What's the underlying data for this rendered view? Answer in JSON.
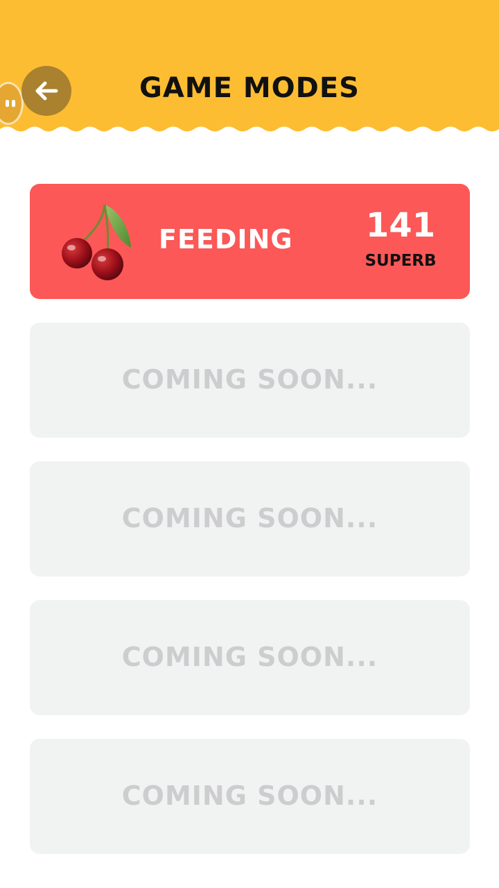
{
  "header": {
    "title": "GAME MODES",
    "back_icon": "arrow-left-icon",
    "colors": {
      "bar": "#fdbd32",
      "back_button": "#a9812f"
    }
  },
  "modes": [
    {
      "label": "FEEDING",
      "icon": "cherry-icon",
      "score": "141",
      "rating": "SUPERB",
      "color": "#fb5857",
      "locked": false
    },
    {
      "label": "COMING SOON...",
      "locked": true
    },
    {
      "label": "COMING SOON...",
      "locked": true
    },
    {
      "label": "COMING SOON...",
      "locked": true
    },
    {
      "label": "COMING SOON...",
      "locked": true
    }
  ]
}
